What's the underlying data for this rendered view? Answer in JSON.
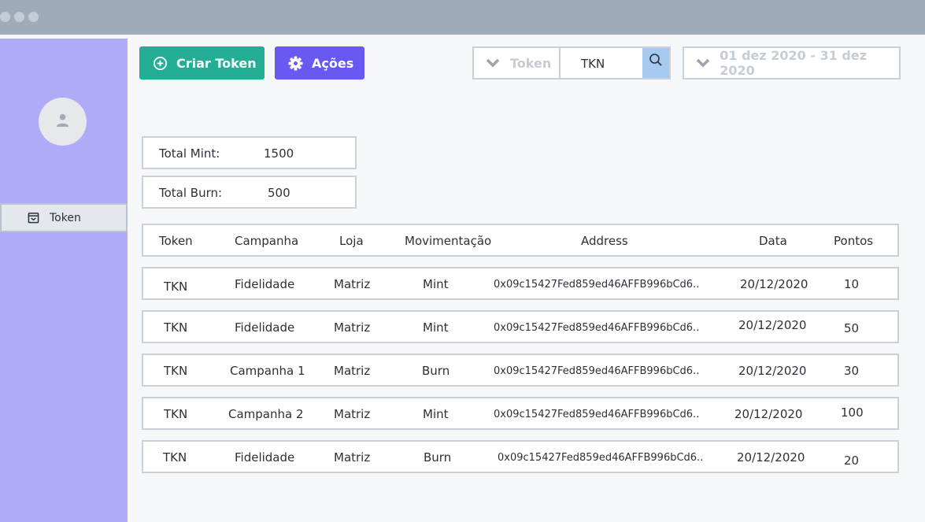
{
  "window": {
    "controls": [
      "close",
      "minimize",
      "maximize"
    ]
  },
  "sidebar": {
    "avatar_icon": "user-icon",
    "items": [
      {
        "label": "Token",
        "icon": "calendar-icon"
      }
    ]
  },
  "toolbar": {
    "create_label": "Criar Token",
    "create_icon": "plus-circle-icon",
    "actions_label": "Ações",
    "actions_icon": "gear-icon",
    "token_filter": {
      "placeholder": "Token",
      "value": "TKN",
      "icon": "search-icon"
    },
    "date_filter": {
      "value": "01 dez 2020 - 31 dez 2020"
    }
  },
  "totals": {
    "mint_label": "Total Mint:",
    "mint_value": "1500",
    "burn_label": "Total Burn:",
    "burn_value": "500"
  },
  "table": {
    "headers": [
      "Token",
      "Campanha",
      "Loja",
      "Movimentação",
      "Address",
      "Data",
      "Pontos"
    ],
    "rows": [
      [
        "TKN",
        "Fidelidade",
        "Matriz",
        "Mint",
        "0x09c15427Fed859ed46AFFB996bCd6..",
        "20/12/2020",
        "10"
      ],
      [
        "TKN",
        "Fidelidade",
        "Matriz",
        "Mint",
        "0x09c15427Fed859ed46AFFB996bCd6..",
        "20/12/2020",
        "50"
      ],
      [
        "TKN",
        "Campanha 1",
        "Matriz",
        "Burn",
        "0x09c15427Fed859ed46AFFB996bCd6..",
        "20/12/2020",
        "30"
      ],
      [
        "TKN",
        "Campanha 2",
        "Matriz",
        "Mint",
        "0x09c15427Fed859ed46AFFB996bCd6..",
        "20/12/2020",
        "100"
      ],
      [
        "TKN",
        "Fidelidade",
        "Matriz",
        "Burn",
        "0x09c15427Fed859ed46AFFB996bCd6..",
        "20/12/2020",
        "20"
      ]
    ]
  },
  "colors": {
    "sidebar": "#b0abf7",
    "create_button": "#21ae95",
    "actions_button": "#6a58f3",
    "search_button": "#a7c9ef",
    "titlebar": "#9eabb9"
  }
}
